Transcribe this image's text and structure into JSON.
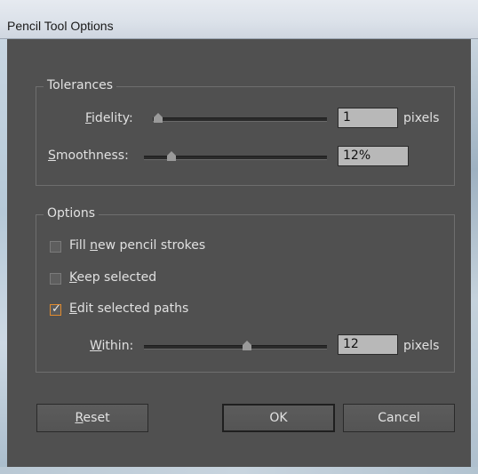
{
  "window": {
    "title": "Pencil Tool Options"
  },
  "tolerances": {
    "legend": "Tolerances",
    "fidelity": {
      "label_prefix": "",
      "label_underline": "F",
      "label_rest": "idelity:",
      "value": "1",
      "unit": "pixels"
    },
    "smoothness": {
      "label_underline": "S",
      "label_rest": "moothness:",
      "value": "12%"
    }
  },
  "options": {
    "legend": "Options",
    "fill_new": {
      "pre": "Fill ",
      "underline": "n",
      "post": "ew pencil strokes",
      "checked": false
    },
    "keep_selected": {
      "pre": "",
      "underline": "K",
      "post": "eep selected",
      "checked": false
    },
    "edit_selected": {
      "pre": "",
      "underline": "E",
      "post": "dit selected paths",
      "checked": true
    },
    "within": {
      "label_underline": "W",
      "label_rest": "ithin:",
      "value": "12",
      "unit": "pixels"
    }
  },
  "buttons": {
    "reset": {
      "underline": "R",
      "rest": "eset"
    },
    "ok": "OK",
    "cancel": "Cancel"
  },
  "colors": {
    "accent_check": "#e08a2e",
    "panel": "#505050"
  },
  "icons": {
    "checkmark": "checkmark-icon"
  }
}
